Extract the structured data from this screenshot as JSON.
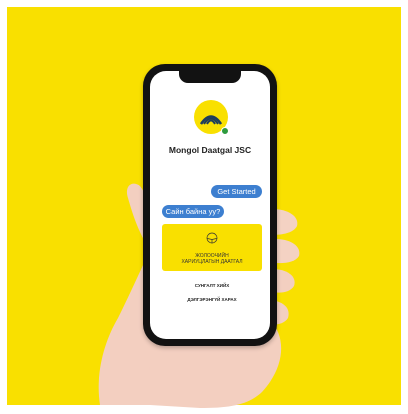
{
  "app": {
    "company_name": "Mongol Daatgal JSC"
  },
  "chat": {
    "user_message": "Get Started",
    "bot_message": "Сайн байна уу?"
  },
  "card": {
    "title_line1": "ЖОЛООЧИЙН",
    "title_line2": "ХАРИУЦЛАГЫН ДААТГАЛ"
  },
  "buttons": {
    "contract_label": "СУНГАЛТ ХИЙХ",
    "details_label": "ДЭЛГЭРЭНГҮЙ ХАРАХ"
  },
  "colors": {
    "background": "#f9e000",
    "chat_bubble": "#3d7fd0",
    "online": "#2e9a3e"
  },
  "icons": [
    "logo-mark-icon",
    "online-dot-icon",
    "steering-wheel-icon"
  ]
}
